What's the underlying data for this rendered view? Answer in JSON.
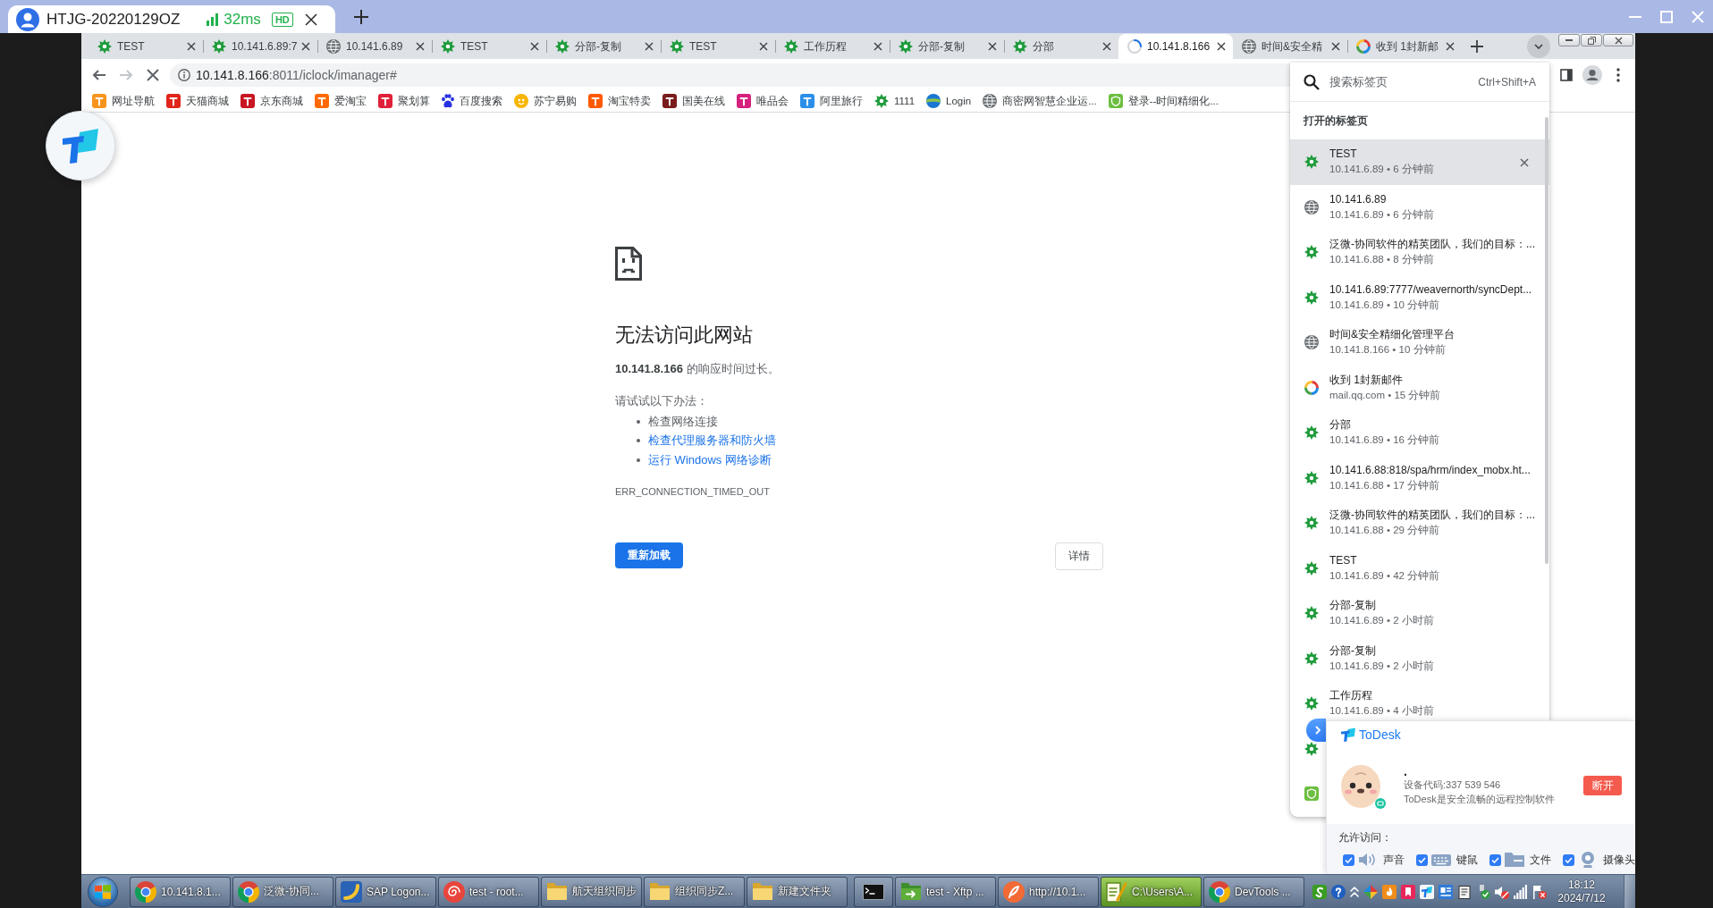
{
  "remote_bar": {
    "title": "HTJG-20220129OZ",
    "latency": "32ms",
    "quality": "HD"
  },
  "browser": {
    "tabs": [
      {
        "title": "TEST",
        "kind": "gear",
        "selected": false
      },
      {
        "title": "10.141.6.89:7",
        "kind": "gear",
        "selected": false
      },
      {
        "title": "10.141.6.89",
        "kind": "globe",
        "selected": false
      },
      {
        "title": "TEST",
        "kind": "gear",
        "selected": false
      },
      {
        "title": "分部-复制",
        "kind": "gear",
        "selected": false
      },
      {
        "title": "TEST",
        "kind": "gear",
        "selected": false
      },
      {
        "title": "工作历程",
        "kind": "gear",
        "selected": false
      },
      {
        "title": "分部-复制",
        "kind": "gear",
        "selected": false
      },
      {
        "title": "分部",
        "kind": "gear",
        "selected": false
      },
      {
        "title": "10.141.8.166",
        "kind": "spinner",
        "selected": true
      },
      {
        "title": "时间&安全精",
        "kind": "globe",
        "selected": false
      },
      {
        "title": "收到 1封新邮",
        "kind": "ring",
        "selected": false
      }
    ],
    "toolbar": {
      "forward_disabled": true,
      "url_host": "10.141.8.166",
      "url_path": ":8011/iclock/imanager#"
    },
    "bookmarks": [
      {
        "label": "网址导航",
        "kind": "tile",
        "color": "#f7941d"
      },
      {
        "label": "天猫商城",
        "kind": "tile",
        "color": "#e1251b"
      },
      {
        "label": "京东商城",
        "kind": "tile",
        "color": "#c81623"
      },
      {
        "label": "爱淘宝",
        "kind": "tile",
        "color": "#ff6a00"
      },
      {
        "label": "聚划算",
        "kind": "tile",
        "color": "#e0203a"
      },
      {
        "label": "百度搜索",
        "kind": "paw"
      },
      {
        "label": "苏宁易购",
        "kind": "dot",
        "color": "#f7b500"
      },
      {
        "label": "淘宝特卖",
        "kind": "tile",
        "color": "#ff5a00"
      },
      {
        "label": "国美在线",
        "kind": "tile",
        "color": "#7a1c1c"
      },
      {
        "label": "唯品会",
        "kind": "tile",
        "color": "#d6207e"
      },
      {
        "label": "阿里旅行",
        "kind": "tile",
        "color": "#2b8ee8"
      },
      {
        "label": "1111",
        "kind": "gear"
      },
      {
        "label": "Login",
        "kind": "earth"
      },
      {
        "label": "商密网智慧企业运...",
        "kind": "globe"
      },
      {
        "label": "登录--时间精细化...",
        "kind": "shield"
      }
    ],
    "error_page": {
      "heading": "无法访问此网站",
      "message": "**10.141.8.166** 的响应时间过长。",
      "intro": "请试试以下办法：",
      "suggestions": [
        {
          "text": "检查网络连接",
          "kind": "text"
        },
        {
          "text": "检查代理服务器和防火墙",
          "kind": "link"
        },
        {
          "text": "运行 Windows 网络诊断",
          "kind": "link"
        }
      ],
      "error_code": "ERR_CONNECTION_TIMED_OUT",
      "reload_button": "重新加载",
      "details_button": "详情"
    },
    "tab_search": {
      "placeholder": "搜索标签页",
      "shortcut": "Ctrl+Shift+A",
      "section_title": "打开的标签页",
      "items": [
        {
          "title": "TEST",
          "subtitle": "10.141.6.89 • 6 分钟前",
          "kind": "gear",
          "selected": true
        },
        {
          "title": "10.141.6.89",
          "subtitle": "10.141.6.89 • 6 分钟前",
          "kind": "globe",
          "selected": false
        },
        {
          "title": "泛微-协同软件的精英团队，我们的目标：...",
          "subtitle": "10.141.6.88 • 8 分钟前",
          "kind": "gear",
          "selected": false
        },
        {
          "title": "10.141.6.89:7777/weavernorth/syncDept...",
          "subtitle": "10.141.6.89 • 10 分钟前",
          "kind": "gear",
          "selected": false
        },
        {
          "title": "时间&安全精细化管理平台",
          "subtitle": "10.141.8.166 • 10 分钟前",
          "kind": "globe",
          "selected": false
        },
        {
          "title": "收到 1封新邮件",
          "subtitle": "mail.qq.com • 15 分钟前",
          "kind": "ring",
          "selected": false
        },
        {
          "title": "分部",
          "subtitle": "10.141.6.89 • 16 分钟前",
          "kind": "gear",
          "selected": false
        },
        {
          "title": "10.141.6.88:818/spa/hrm/index_mobx.ht...",
          "subtitle": "10.141.6.88 • 17 分钟前",
          "kind": "gear",
          "selected": false
        },
        {
          "title": "泛微-协同软件的精英团队，我们的目标：...",
          "subtitle": "10.141.6.88 • 29 分钟前",
          "kind": "gear",
          "selected": false
        },
        {
          "title": "TEST",
          "subtitle": "10.141.6.89 • 42 分钟前",
          "kind": "gear",
          "selected": false
        },
        {
          "title": "分部-复制",
          "subtitle": "10.141.6.89 • 2 小时前",
          "kind": "gear",
          "selected": false
        },
        {
          "title": "分部-复制",
          "subtitle": "10.141.6.89 • 2 小时前",
          "kind": "gear",
          "selected": false
        },
        {
          "title": "工作历程",
          "subtitle": "10.141.6.89 • 4 小时前",
          "kind": "gear",
          "selected": false
        },
        {
          "kind": "gear",
          "selected": false
        },
        {
          "kind": "shield",
          "selected": false
        }
      ]
    }
  },
  "todesk": {
    "brand": "ToDesk",
    "device_name": ".",
    "device_code": "设备代码:337 539 546",
    "tagline": "ToDesk是安全流畅的远程控制软件",
    "disconnect_button": "断开",
    "permissions_title": "允许访问：",
    "permissions": [
      {
        "label": "声音",
        "kind": "speaker",
        "checked": true
      },
      {
        "label": "键鼠",
        "kind": "keyboard",
        "checked": true
      },
      {
        "label": "文件",
        "kind": "folder",
        "checked": true
      },
      {
        "label": "摄像头",
        "kind": "camera",
        "checked": true
      }
    ]
  },
  "taskbar": {
    "items": [
      {
        "label": "10.141.8.1...",
        "kind": "chrome",
        "hovered": false
      },
      {
        "label": "泛微-协同...",
        "kind": "chrome",
        "hovered": false
      },
      {
        "label": "SAP Logon...",
        "kind": "sap",
        "hovered": false
      },
      {
        "label": "test - root...",
        "kind": "swirl",
        "hovered": false
      },
      {
        "label": "航天组织同步",
        "kind": "folder",
        "hovered": false
      },
      {
        "label": "组织同步Z...",
        "kind": "folder",
        "hovered": false
      },
      {
        "label": "新建文件夹",
        "kind": "folder",
        "hovered": false
      },
      {
        "kind": "terminal",
        "hovered": false
      },
      {
        "label": "test - Xftp ...",
        "kind": "xftp",
        "hovered": false
      },
      {
        "label": "http://10.1...",
        "kind": "feather",
        "hovered": false
      },
      {
        "label": "C:\\Users\\A...",
        "kind": "editor",
        "hovered": true
      },
      {
        "label": "DevTools ...",
        "kind": "chrome",
        "hovered": false
      }
    ],
    "clock": {
      "time": "18:12",
      "date": "2024/7/12"
    }
  }
}
